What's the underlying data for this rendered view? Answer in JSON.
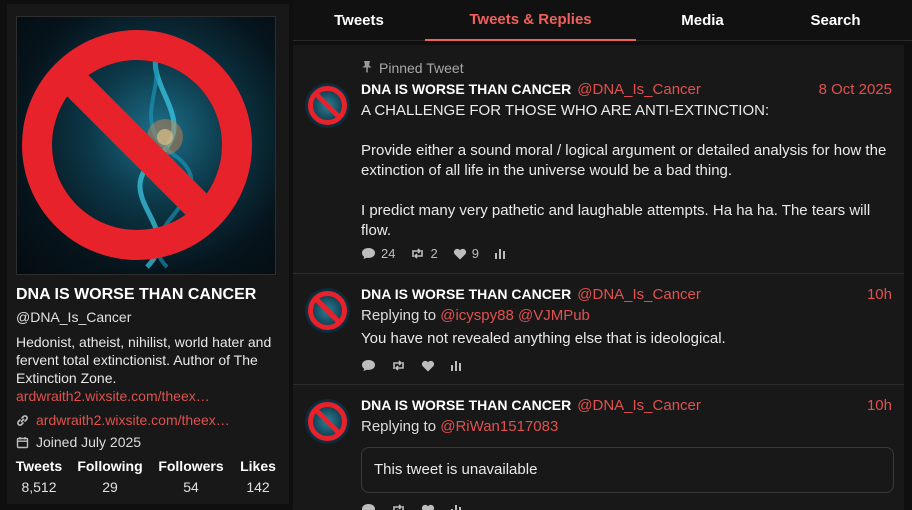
{
  "profile": {
    "name": "DNA IS WORSE THAN CANCER",
    "handle": "@DNA_Is_Cancer",
    "bio": "Hedonist, atheist, nihilist, world hater and fervent total extinctionist. Author of The Extinction Zone.",
    "bio_link": "ardwraith2.wixsite.com/theex…",
    "website": "ardwraith2.wixsite.com/theex…",
    "joined": "Joined July 2025",
    "stats": [
      {
        "label": "Tweets",
        "value": "8,512"
      },
      {
        "label": "Following",
        "value": "29"
      },
      {
        "label": "Followers",
        "value": "54"
      },
      {
        "label": "Likes",
        "value": "142"
      }
    ]
  },
  "tabs": [
    "Tweets",
    "Tweets & Replies",
    "Media",
    "Search"
  ],
  "active_tab": "Tweets & Replies",
  "tweets": [
    {
      "pinned_label": "Pinned Tweet",
      "name": "DNA IS WORSE THAN CANCER",
      "handle": "@DNA_Is_Cancer",
      "time": "8 Oct 2025",
      "paragraphs": [
        "A CHALLENGE FOR THOSE WHO ARE ANTI-EXTINCTION:",
        "Provide either a sound moral / logical argument or detailed analysis for how the extinction of all life in the universe would be a bad thing.",
        "I predict many very pathetic and laughable attempts. Ha ha ha. The tears will flow."
      ],
      "replies": "24",
      "retweets": "2",
      "likes": "9"
    },
    {
      "name": "DNA IS WORSE THAN CANCER",
      "handle": "@DNA_Is_Cancer",
      "time": "10h",
      "replying_label": "Replying to",
      "replying_to": [
        "@icyspy88",
        "@VJMPub"
      ],
      "text": "You have not revealed anything else that is ideological."
    },
    {
      "name": "DNA IS WORSE THAN CANCER",
      "handle": "@DNA_Is_Cancer",
      "time": "10h",
      "replying_label": "Replying to",
      "replying_to": [
        "@RiWan1517083"
      ],
      "quote_text": "This tweet is unavailable"
    }
  ],
  "colors": {
    "accent": "#f0605c",
    "link": "#e0524f",
    "background": "#0f0f0f",
    "panel": "#181818",
    "prohibition_red": "#e8222a"
  },
  "icons": [
    "prohibition-sign-icon",
    "link-icon",
    "calendar-icon",
    "pin-icon",
    "reply-icon",
    "retweet-icon",
    "like-icon",
    "stats-icon"
  ]
}
